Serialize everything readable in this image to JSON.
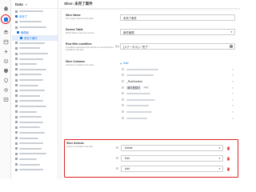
{
  "tree": {
    "title": "Data",
    "caret": "▾",
    "items": [
      {
        "label": "",
        "kind": "bar"
      },
      {
        "label": "未完了",
        "kind": "link"
      },
      {
        "label": "",
        "kind": "bar"
      },
      {
        "label": "",
        "kind": "bar"
      },
      {
        "label": "管理者",
        "kind": "link"
      },
      {
        "label": "未完了案件",
        "kind": "link",
        "selected": true
      },
      {
        "label": "",
        "kind": "bar"
      },
      {
        "label": "",
        "kind": "bar"
      },
      {
        "label": "",
        "kind": "bar"
      },
      {
        "label": "",
        "kind": "bar"
      },
      {
        "label": "",
        "kind": "bar"
      },
      {
        "label": "",
        "kind": "bar"
      },
      {
        "label": "",
        "kind": "bar"
      },
      {
        "label": "",
        "kind": "bar"
      },
      {
        "label": "",
        "kind": "bar"
      },
      {
        "label": "",
        "kind": "bar"
      },
      {
        "label": "",
        "kind": "bar"
      },
      {
        "label": "",
        "kind": "bar"
      },
      {
        "label": "",
        "kind": "bar"
      },
      {
        "label": "",
        "kind": "bar"
      },
      {
        "label": "",
        "kind": "bar"
      },
      {
        "label": "",
        "kind": "bar"
      },
      {
        "label": "",
        "kind": "bar"
      },
      {
        "label": "",
        "kind": "bar"
      },
      {
        "label": "",
        "kind": "bar"
      },
      {
        "label": "",
        "kind": "bar"
      },
      {
        "label": "",
        "kind": "bar"
      },
      {
        "label": "",
        "kind": "bar"
      },
      {
        "label": "",
        "kind": "bar"
      },
      {
        "label": "",
        "kind": "bar"
      },
      {
        "label": "",
        "kind": "bar"
      }
    ]
  },
  "main": {
    "title": "Slice: 未完了案件"
  },
  "slice_name": {
    "label": "Slice Name",
    "desc": "The unique name for this slice",
    "value": "未完了案件"
  },
  "source_table": {
    "label": "Source Table",
    "desc": "Which table to use as a source",
    "value": "案件管理"
  },
  "row_filter": {
    "label": "Row filter condition",
    "desc": "True/false expression that checks if a row should be included in the slice",
    "fn": "f(x)",
    "value": "[ステータス] = \"完了\""
  },
  "slice_columns": {
    "label": "Slice Columns",
    "desc": "Columns to include in the slice",
    "add_label": "Add",
    "items": [
      {
        "label": "",
        "kind": "bar"
      },
      {
        "label": "",
        "kind": "bar"
      },
      {
        "label": "_RowNumber",
        "kind": "text"
      },
      {
        "label": "案件登録日",
        "kind": "chip",
        "badge": "Key"
      },
      {
        "label": "",
        "kind": "bar"
      },
      {
        "label": "",
        "kind": "bar"
      },
      {
        "label": "",
        "kind": "bar"
      },
      {
        "label": "",
        "kind": "bar"
      },
      {
        "label": "",
        "kind": "bar"
      }
    ]
  },
  "slice_actions": {
    "label": "Slice Actions",
    "desc": "Actions to include in the slice",
    "items": [
      {
        "value": "Delete"
      },
      {
        "value": "Edit"
      },
      {
        "value": "Add"
      }
    ]
  },
  "colors": {
    "highlight": "#e02020",
    "link": "#1a73e8",
    "delete": "#d93025"
  }
}
